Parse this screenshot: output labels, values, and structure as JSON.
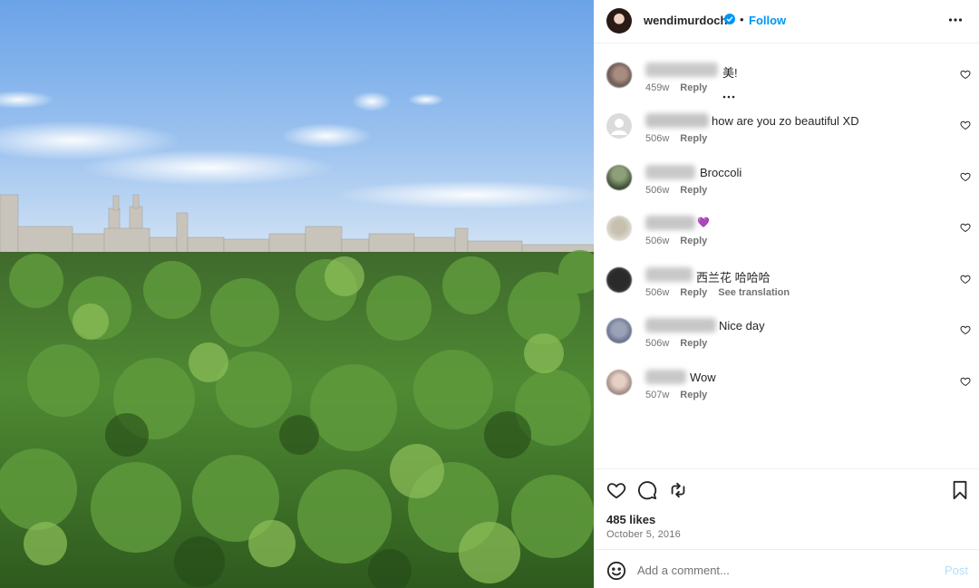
{
  "post": {
    "username": "wendimurdoch",
    "separator": "•",
    "follow_label": "Follow",
    "verified_icon": "verified-badge-icon",
    "likes": "485 likes",
    "date": "October 5, 2016",
    "photo_description_icon": "central-park-photo"
  },
  "comments": [
    {
      "user": "hejingwan1010",
      "text": "美!",
      "age": "459w",
      "reply": "Reply",
      "translation": "",
      "has_more": true
    },
    {
      "user": "mutlimsl0069",
      "text": "how are you zo beautiful XD",
      "age": "506w",
      "reply": "Reply",
      "translation": "",
      "has_more": false
    },
    {
      "user": "chen5512",
      "text": "Broccoli",
      "age": "506w",
      "reply": "Reply",
      "translation": "",
      "has_more": false
    },
    {
      "user": "rareell026",
      "text": "💜",
      "age": "506w",
      "reply": "Reply",
      "translation": "",
      "has_more": false
    },
    {
      "user": "franfeoo",
      "text": "西兰花 哈哈哈",
      "age": "506w",
      "reply": "Reply",
      "translation": "See translation",
      "has_more": false
    },
    {
      "user": "jenniferyiling",
      "text": "Nice day",
      "age": "506w",
      "reply": "Reply",
      "translation": "",
      "has_more": false
    },
    {
      "user": "joonesh",
      "text": "Wow",
      "age": "507w",
      "reply": "Reply",
      "translation": "",
      "has_more": false
    }
  ],
  "composer": {
    "placeholder": "Add a comment...",
    "post_label": "Post"
  },
  "colors": {
    "accent": "#0095f6",
    "post_disabled": "#b2dffc",
    "meta_text": "#737373",
    "primary_text": "#262626"
  }
}
